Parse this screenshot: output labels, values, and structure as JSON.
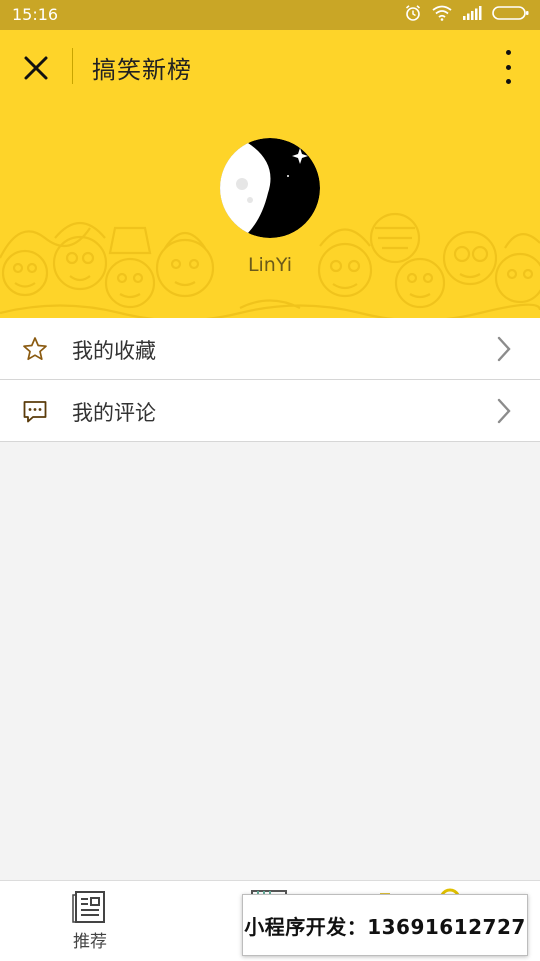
{
  "status_bar": {
    "time": "15:16",
    "icons": [
      "alarm-icon",
      "wifi-icon",
      "signal-icon",
      "battery-icon"
    ]
  },
  "header": {
    "title": "搞笑新榜",
    "close_icon": "close-icon",
    "more_icon": "more-vertical-icon",
    "background_color": "#fed429"
  },
  "profile": {
    "username": "LinYi"
  },
  "menu": {
    "items": [
      {
        "label": "我的收藏",
        "icon": "star-icon"
      },
      {
        "label": "我的评论",
        "icon": "comment-icon"
      }
    ]
  },
  "bottom_nav": {
    "tabs": [
      {
        "label": "推荐",
        "icon": "news-icon"
      }
    ]
  },
  "ad_banner": {
    "text": "小程序开发：13691612727"
  }
}
